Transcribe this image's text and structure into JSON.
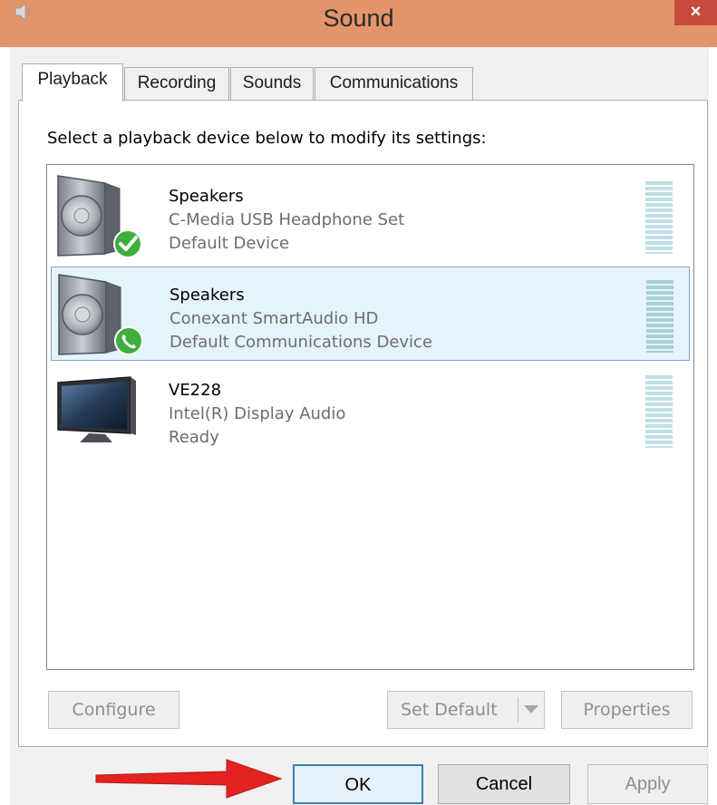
{
  "window": {
    "title": "Sound",
    "close_label": "×"
  },
  "tabs": [
    {
      "label": "Playback",
      "active": true
    },
    {
      "label": "Recording",
      "active": false
    },
    {
      "label": "Sounds",
      "active": false
    },
    {
      "label": "Communications",
      "active": false
    }
  ],
  "playback": {
    "instruction": "Select a playback device below to modify its settings:",
    "devices": [
      {
        "name": "Speakers",
        "driver": "C-Media USB Headphone Set",
        "status": "Default Device",
        "icon": "speaker-icon",
        "badge": "default-check-badge-icon",
        "selected": false
      },
      {
        "name": "Speakers",
        "driver": "Conexant SmartAudio HD",
        "status": "Default Communications Device",
        "icon": "speaker-icon",
        "badge": "communications-phone-badge-icon",
        "selected": true
      },
      {
        "name": "VE228",
        "driver": "Intel(R) Display Audio",
        "status": "Ready",
        "icon": "monitor-icon",
        "badge": "",
        "selected": false
      }
    ],
    "buttons": {
      "configure": "Configure",
      "set_default": "Set Default",
      "properties": "Properties"
    }
  },
  "dialog_buttons": {
    "ok": "OK",
    "cancel": "Cancel",
    "apply": "Apply"
  },
  "colors": {
    "titlebar": "#e4946a",
    "close": "#c74a3e",
    "selection": "#e5f3fb",
    "ok_border": "#3c7fb1",
    "arrow": "#e3231f",
    "check_badge": "#3fae3f"
  }
}
